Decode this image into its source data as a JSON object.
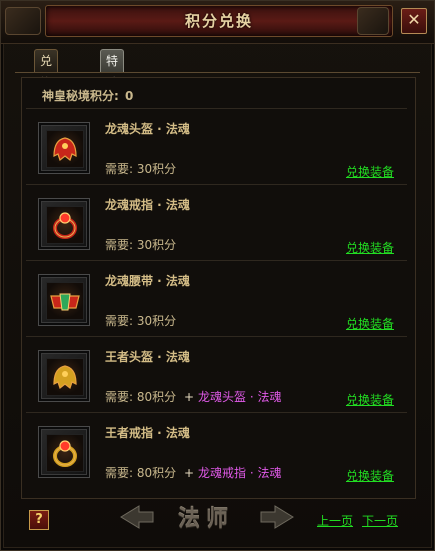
{
  "window": {
    "title": "积分兑换"
  },
  "tabs": [
    {
      "label": "兑换装备",
      "active": true
    },
    {
      "label": "特殊兑换",
      "active": false
    }
  ],
  "score": {
    "label": "神皇秘境积分:",
    "value": "0"
  },
  "items": [
    {
      "name": "龙魂头盔 · 法魂",
      "cost": "需要: 30积分",
      "extra": "",
      "action": "兑换装备",
      "icon": "helmet-icon",
      "glow": "#c8261a"
    },
    {
      "name": "龙魂戒指 · 法魂",
      "cost": "需要: 30积分",
      "extra": "",
      "action": "兑换装备",
      "icon": "ring-icon",
      "glow": "#c8261a"
    },
    {
      "name": "龙魂腰带 · 法魂",
      "cost": "需要: 30积分",
      "extra": "",
      "action": "兑换装备",
      "icon": "belt-icon",
      "glow": "#c8261a"
    },
    {
      "name": "王者头盔 · 法魂",
      "cost": "需要: 80积分",
      "extra": "龙魂头盔 · 法魂",
      "action": "兑换装备",
      "icon": "helmet-icon",
      "glow": "#d4a020"
    },
    {
      "name": "王者戒指 · 法魂",
      "cost": "需要: 80积分",
      "extra": "龙魂戒指 · 法魂",
      "action": "兑换装备",
      "icon": "ring-icon",
      "glow": "#d4a020"
    }
  ],
  "footer": {
    "help": "?",
    "class_name": "法师",
    "prev": "上一页",
    "next": "下一页"
  },
  "colors": {
    "accent_green": "#22dd22",
    "requirement_magenta": "#e05ae8",
    "title_plate": "#5a1a15"
  }
}
